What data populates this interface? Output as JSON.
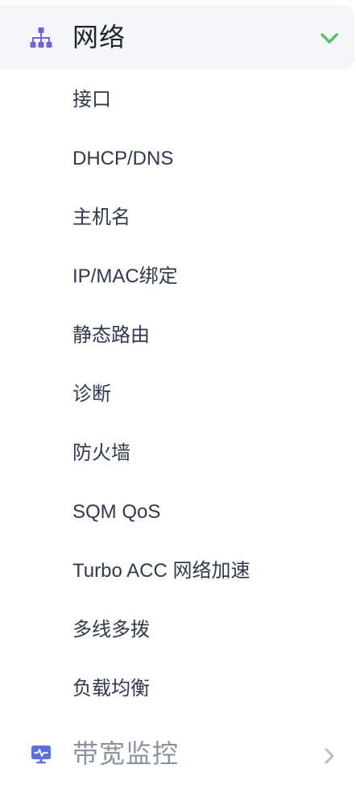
{
  "network_group": {
    "title": "网络",
    "icon": "network-tree-icon",
    "expanded": true,
    "accent_color": "#7b5fd6",
    "chevron_color": "#5bbf6a",
    "items": [
      {
        "label": "接口"
      },
      {
        "label": "DHCP/DNS"
      },
      {
        "label": "主机名"
      },
      {
        "label": "IP/MAC绑定"
      },
      {
        "label": "静态路由"
      },
      {
        "label": "诊断"
      },
      {
        "label": "防火墙"
      },
      {
        "label": "SQM QoS"
      },
      {
        "label": "Turbo ACC 网络加速"
      },
      {
        "label": "多线多拨"
      },
      {
        "label": "负载均衡"
      }
    ]
  },
  "bandwidth_group": {
    "title": "带宽监控",
    "icon": "monitor-icon",
    "expanded": false,
    "icon_color": "#5b6fe0"
  }
}
